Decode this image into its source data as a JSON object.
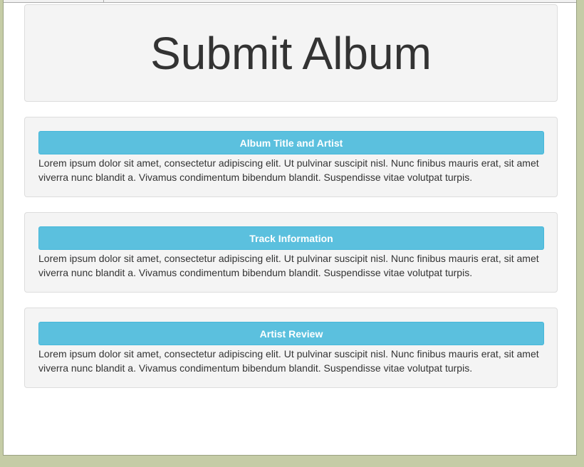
{
  "page": {
    "title": "Submit Album"
  },
  "sections": [
    {
      "button_label": "Album Title and Artist",
      "text": "Lorem ipsum dolor sit amet, consectetur adipiscing elit. Ut pulvinar suscipit nisl. Nunc finibus mauris erat, sit amet viverra nunc blandit a. Vivamus condimentum bibendum blandit. Suspendisse vitae volutpat turpis."
    },
    {
      "button_label": "Track Information",
      "text": "Lorem ipsum dolor sit amet, consectetur adipiscing elit. Ut pulvinar suscipit nisl. Nunc finibus mauris erat, sit amet viverra nunc blandit a. Vivamus condimentum bibendum blandit. Suspendisse vitae volutpat turpis."
    },
    {
      "button_label": "Artist Review",
      "text": "Lorem ipsum dolor sit amet, consectetur adipiscing elit. Ut pulvinar suscipit nisl. Nunc finibus mauris erat, sit amet viverra nunc blandit a. Vivamus condimentum bibendum blandit. Suspendisse vitae volutpat turpis."
    }
  ],
  "colors": {
    "button_bg": "#5bc0de",
    "button_border": "#46b8da",
    "panel_bg": "#f4f4f4",
    "text": "#333333"
  }
}
